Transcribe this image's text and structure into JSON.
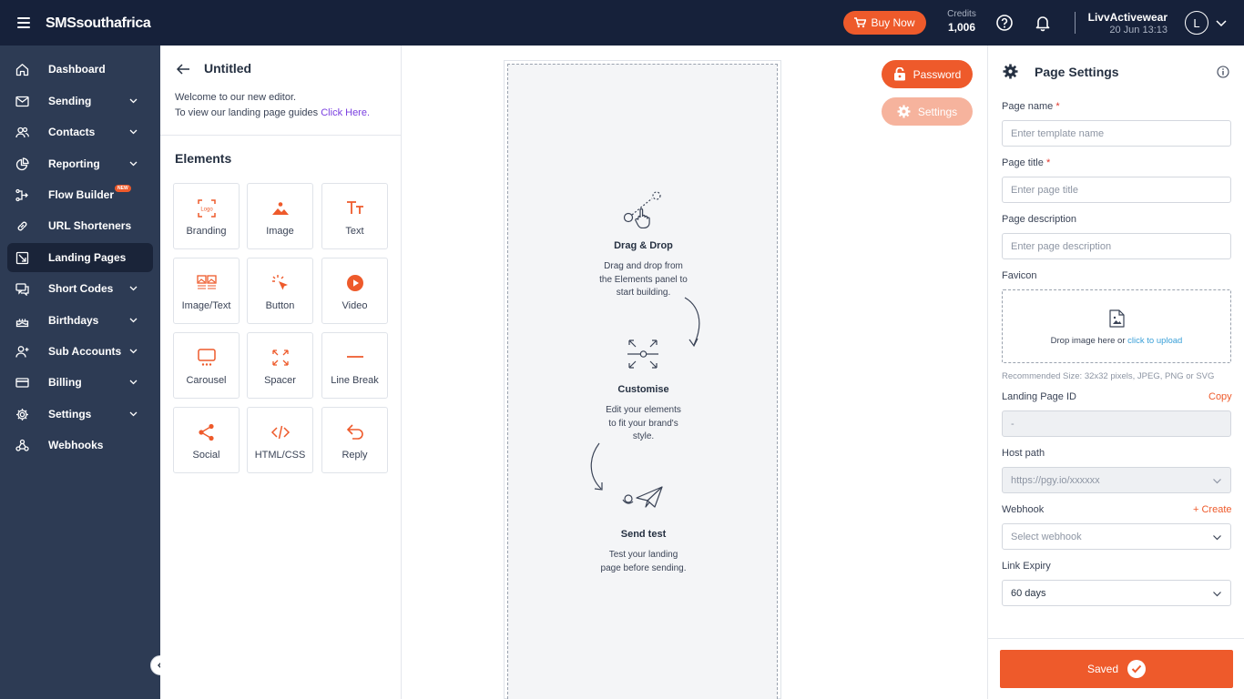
{
  "app": {
    "brand": "SMSsouthafrica",
    "buy_now": "Buy Now",
    "credits_label": "Credits",
    "credits_value": "1,006",
    "account_name": "LivvActivewear",
    "account_date": "20 Jun 13:13",
    "avatar_initial": "L",
    "colors": {
      "topbar": "#16213a",
      "sidebar": "#2d3b54",
      "accent": "#ee5a2b"
    }
  },
  "sidebar": {
    "items": [
      {
        "label": "Dashboard",
        "icon": "home-icon",
        "chevron": false
      },
      {
        "label": "Sending",
        "icon": "mail-icon",
        "chevron": true
      },
      {
        "label": "Contacts",
        "icon": "users-icon",
        "chevron": true
      },
      {
        "label": "Reporting",
        "icon": "pie-chart-icon",
        "chevron": true
      },
      {
        "label": "Flow Builder",
        "icon": "flow-icon",
        "chevron": false,
        "badge": "NEW"
      },
      {
        "label": "URL Shorteners",
        "icon": "link-icon",
        "chevron": false
      },
      {
        "label": "Landing Pages",
        "icon": "landing-page-icon",
        "chevron": false,
        "active": true
      },
      {
        "label": "Short Codes",
        "icon": "chat-icon",
        "chevron": true
      },
      {
        "label": "Birthdays",
        "icon": "cake-icon",
        "chevron": true
      },
      {
        "label": "Sub Accounts",
        "icon": "user-plus-icon",
        "chevron": true
      },
      {
        "label": "Billing",
        "icon": "card-icon",
        "chevron": true
      },
      {
        "label": "Settings",
        "icon": "gear-icon",
        "chevron": true
      },
      {
        "label": "Webhooks",
        "icon": "webhook-icon",
        "chevron": false
      }
    ]
  },
  "editor": {
    "title": "Untitled",
    "welcome_line1": "Welcome to our new editor.",
    "welcome_line2": "To view our landing page guides ",
    "welcome_link": "Click Here.",
    "elements_heading": "Elements",
    "elements": [
      {
        "label": "Branding",
        "icon": "logo-icon"
      },
      {
        "label": "Image",
        "icon": "image-icon"
      },
      {
        "label": "Text",
        "icon": "text-icon"
      },
      {
        "label": "Image/Text",
        "icon": "image-text-icon"
      },
      {
        "label": "Button",
        "icon": "cursor-click-icon"
      },
      {
        "label": "Video",
        "icon": "play-icon"
      },
      {
        "label": "Carousel",
        "icon": "carousel-icon"
      },
      {
        "label": "Spacer",
        "icon": "spacer-icon"
      },
      {
        "label": "Line Break",
        "icon": "line-break-icon"
      },
      {
        "label": "Social",
        "icon": "share-icon"
      },
      {
        "label": "HTML/CSS",
        "icon": "code-icon"
      },
      {
        "label": "Reply",
        "icon": "reply-icon"
      }
    ]
  },
  "canvas": {
    "password_btn": "Password",
    "settings_btn": "Settings",
    "steps": [
      {
        "title": "Drag & Drop",
        "desc": [
          "Drag and drop from",
          "the Elements panel to",
          "start building."
        ]
      },
      {
        "title": "Customise",
        "desc": [
          "Edit your elements",
          "to fit your brand's",
          "style."
        ]
      },
      {
        "title": "Send test",
        "desc": [
          "Test your landing",
          "page before sending."
        ]
      }
    ]
  },
  "page_settings": {
    "title": "Page Settings",
    "page_name_label": "Page name",
    "page_name_placeholder": "Enter template name",
    "page_title_label": "Page title",
    "page_title_placeholder": "Enter page title",
    "page_desc_label": "Page description",
    "page_desc_placeholder": "Enter page description",
    "favicon_label": "Favicon",
    "drop_text": "Drop image here or ",
    "drop_link": "click to upload",
    "recommended": "Recommended Size: 32x32 pixels, JPEG, PNG or SVG",
    "landing_id_label": "Landing Page ID",
    "copy": "Copy",
    "landing_id_value": "-",
    "host_path_label": "Host path",
    "host_path_value": "https://pgy.io/xxxxxx",
    "webhook_label": "Webhook",
    "webhook_create": "+ Create",
    "webhook_placeholder": "Select webhook",
    "link_expiry_label": "Link Expiry",
    "link_expiry_value": "60 days",
    "required_mark": "*",
    "saved": "Saved"
  }
}
